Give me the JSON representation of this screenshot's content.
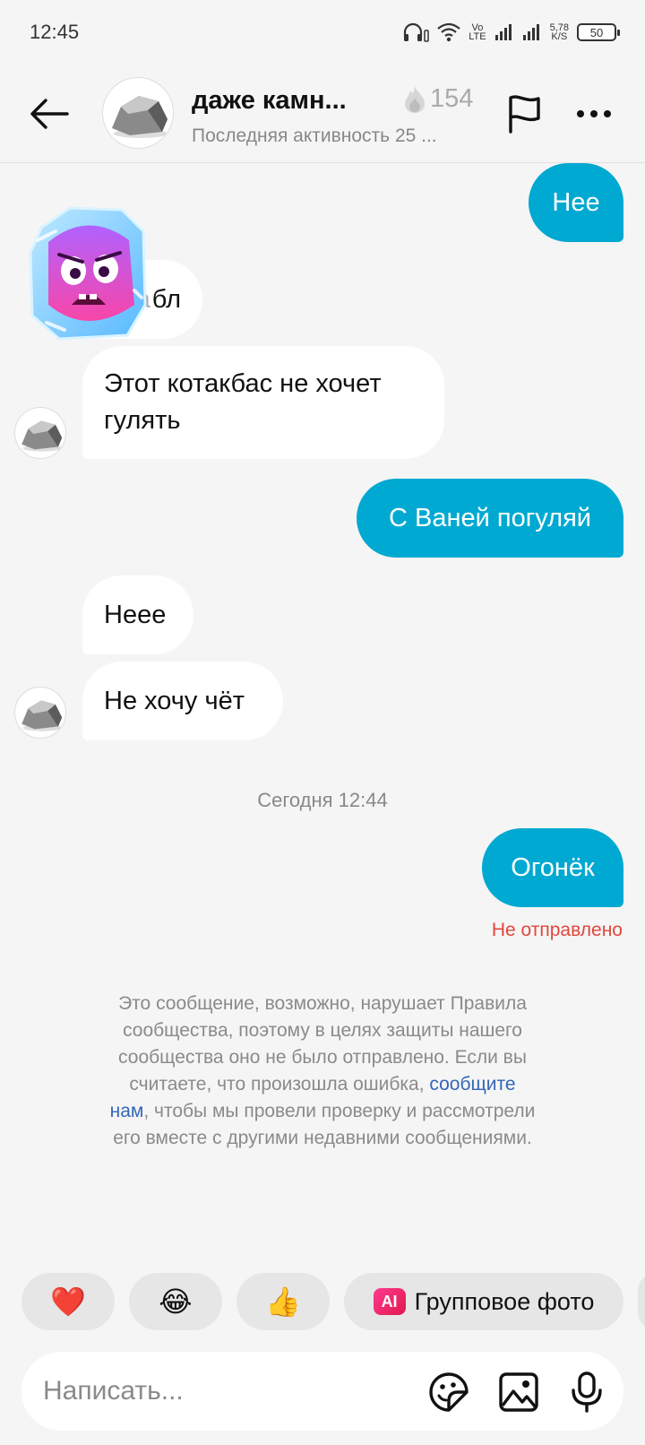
{
  "status_bar": {
    "time": "12:45",
    "network_label_top": "Vo",
    "network_label_bottom": "LTE",
    "speed_value": "5,78",
    "speed_unit": "K/S",
    "battery": "50"
  },
  "header": {
    "name": "даже камн...",
    "streak_icon": "fire-icon",
    "streak_count": "154",
    "status": "Последняя активность 25 ..."
  },
  "messages": [
    {
      "direction": "out",
      "text": "Нее"
    },
    {
      "direction": "in",
      "text": "бл",
      "partially_covered_text": "а",
      "covered_by": "sticker-ice-face"
    },
    {
      "direction": "in",
      "text_line1": "Этот котакбас не хочет",
      "text_line2": "гулять"
    },
    {
      "direction": "out",
      "text": "С Ваней погуляй"
    },
    {
      "direction": "in",
      "text": "Неее"
    },
    {
      "direction": "in",
      "text": "Не хочу чёт"
    },
    {
      "direction": "out",
      "text": "Огонёк"
    }
  ],
  "date_separator": "Сегодня 12:44",
  "delivery_status": "Не отправлено",
  "notice": {
    "text_before_link": "Это сообщение, возможно, нарушает Правила сообщества, поэтому в целях защиты нашего сообщества оно не было отправлено. Если вы считаете, что произошла ошибка, ",
    "link": "сообщите нам",
    "text_after_link": ", чтобы мы провели проверку и рассмотрели его вместе с другими недавними сообщениями."
  },
  "quick_reactions": [
    {
      "emoji": "❤️",
      "name": "heart"
    },
    {
      "emoji": "😂",
      "name": "laughing"
    },
    {
      "emoji": "👍",
      "name": "thumbs-up"
    }
  ],
  "group_photo": {
    "badge": "AI",
    "label": "Групповое фото"
  },
  "composer": {
    "placeholder": "Написать..."
  },
  "colors": {
    "outgoing_bubble": "#00a9d1",
    "incoming_bubble": "#ffffff",
    "background": "#f5f5f5",
    "error": "#e2473b",
    "link": "#3466b8"
  }
}
